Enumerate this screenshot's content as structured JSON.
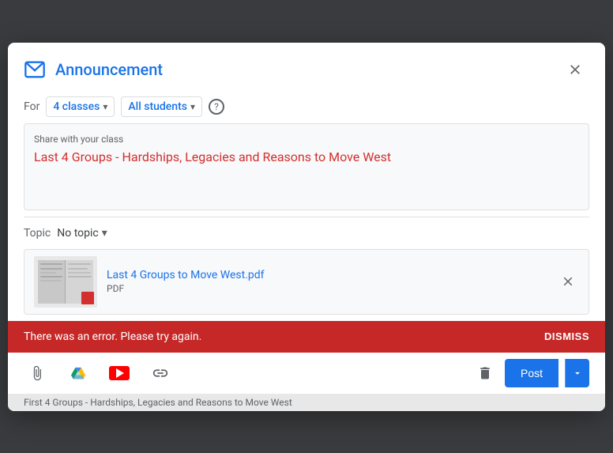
{
  "dialog": {
    "title": "Announcement",
    "close_label": "×"
  },
  "for_row": {
    "label": "For",
    "classes_value": "4 classes",
    "students_value": "All students"
  },
  "text_area": {
    "placeholder": "Share with your class",
    "content_prefix": "Last 4 Groups - Hardships, Legacies and Reasons to Move West"
  },
  "topic": {
    "label": "Topic",
    "value": "No topic"
  },
  "attachment": {
    "name_prefix": "Last 4 Groups to ",
    "name_link": "Move West",
    "name_suffix": ".pdf",
    "type": "PDF"
  },
  "error": {
    "message": "There was an error. Please try again.",
    "dismiss_label": "DISMISS"
  },
  "footer": {
    "post_label": "Post"
  },
  "bottom_hint": {
    "text": "First 4 Groups - Hardships, Legacies and Reasons to Move West"
  }
}
